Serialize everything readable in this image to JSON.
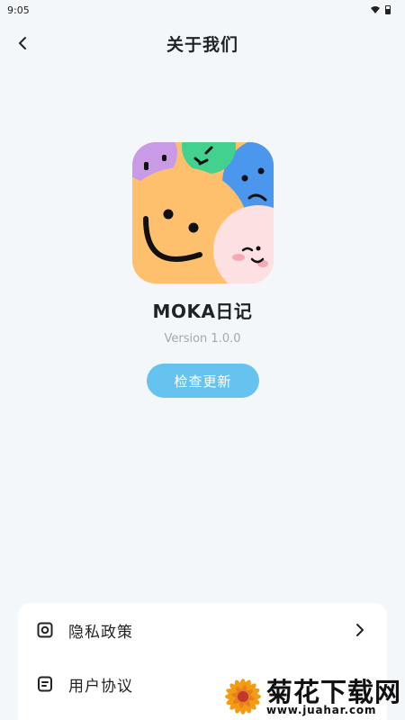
{
  "status_bar": {
    "time": "9:05",
    "wifi_icon": "wifi-icon",
    "battery_icon": "battery-icon"
  },
  "header": {
    "title": "关于我们",
    "back_icon": "back-arrow-icon"
  },
  "app": {
    "name": "MOKA日记",
    "version": "Version 1.0.0",
    "logo_icon": "moka-smiley-logo"
  },
  "update_button": {
    "label": "检查更新",
    "color": "#66c3f0"
  },
  "menu": {
    "items": [
      {
        "label": "隐私政策",
        "icon": "privacy-icon",
        "has_chevron": true
      },
      {
        "label": "用户协议",
        "icon": "document-icon",
        "has_chevron": false
      }
    ]
  },
  "watermark": {
    "text": "菊花下载网",
    "url": "www.juahar.com"
  },
  "colors": {
    "background": "#f4f7f9",
    "accent": "#66c3f0",
    "card": "#ffffff"
  }
}
